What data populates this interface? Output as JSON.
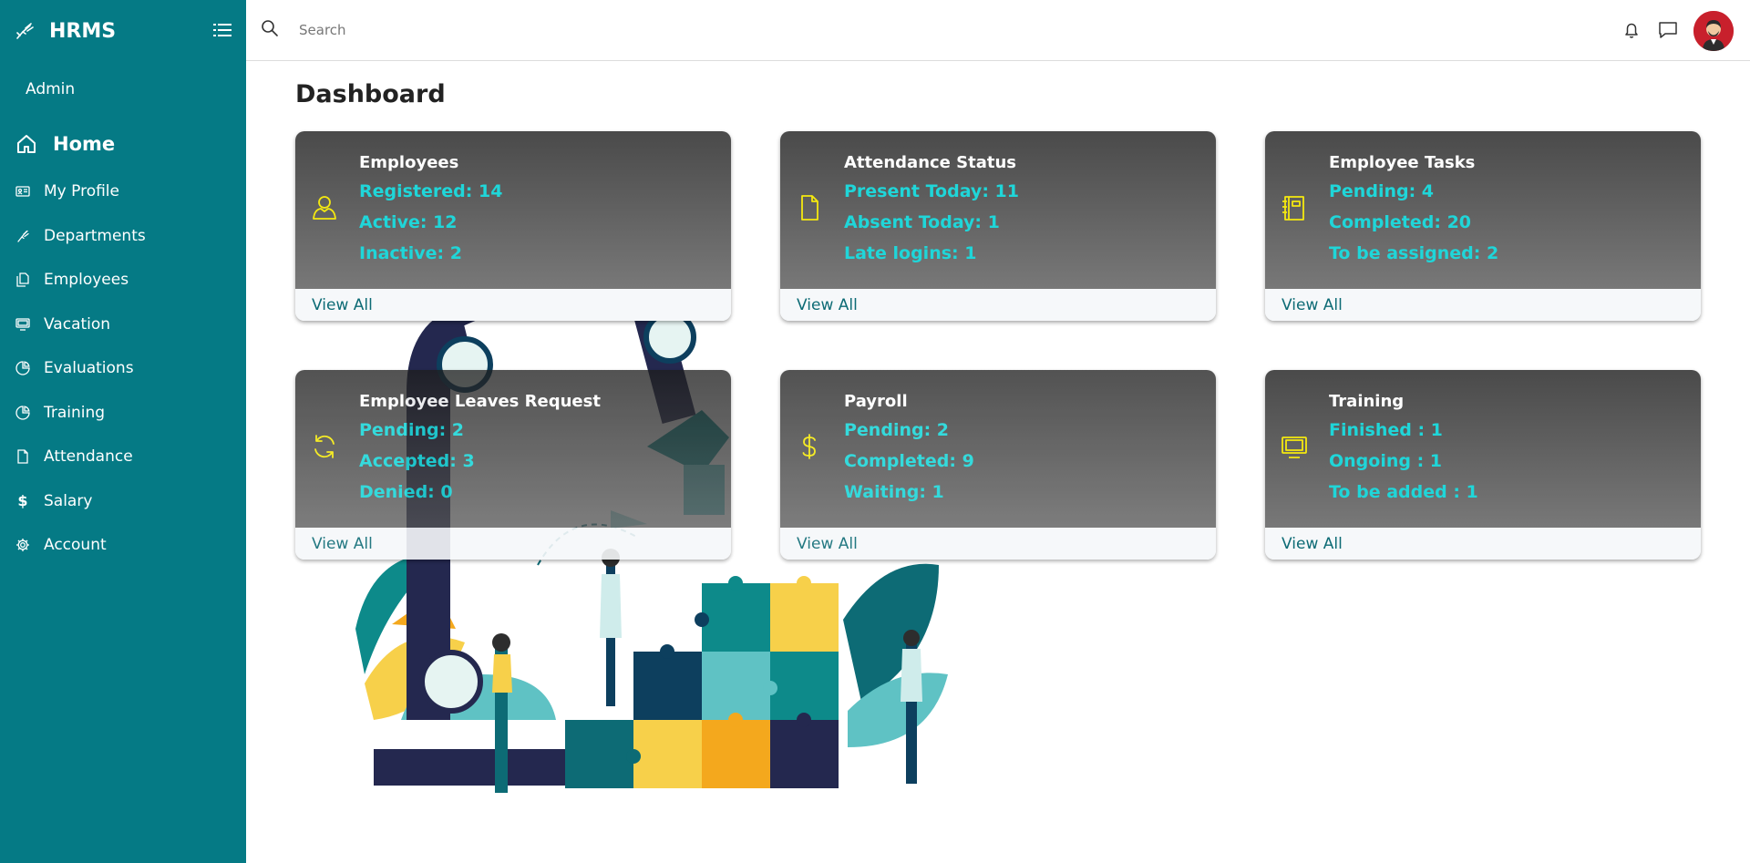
{
  "app": {
    "name": "HRMS",
    "role": "Admin"
  },
  "sidebar": {
    "items": [
      {
        "label": "Home",
        "icon": "home-icon"
      },
      {
        "label": "My Profile",
        "icon": "id-card-icon"
      },
      {
        "label": "Departments",
        "icon": "hand-icon"
      },
      {
        "label": "Employees",
        "icon": "documents-icon"
      },
      {
        "label": "Vacation",
        "icon": "monitor-icon"
      },
      {
        "label": "Evaluations",
        "icon": "pie-chart-icon"
      },
      {
        "label": "Training",
        "icon": "pie-chart-icon"
      },
      {
        "label": "Attendance",
        "icon": "file-icon"
      },
      {
        "label": "Salary",
        "icon": "dollar-icon"
      },
      {
        "label": "Account",
        "icon": "gear-icon"
      }
    ]
  },
  "header": {
    "search_placeholder": "Search"
  },
  "main": {
    "title": "Dashboard"
  },
  "cards": [
    {
      "title": "Employees",
      "icon": "user-icon",
      "lines": [
        "Registered: 14",
        "Active: 12",
        "Inactive: 2"
      ],
      "footer": "View All"
    },
    {
      "title": "Attendance Status",
      "icon": "file-icon",
      "lines": [
        "Present Today: 11",
        "Absent Today: 1",
        "Late logins: 1"
      ],
      "footer": "View All"
    },
    {
      "title": "Employee Tasks",
      "icon": "notebook-icon",
      "lines": [
        "Pending: 4",
        "Completed: 20",
        "To be assigned: 2"
      ],
      "footer": "View All"
    },
    {
      "title": "Employee Leaves Request",
      "icon": "refresh-icon",
      "lines": [
        "Pending: 2",
        "Accepted: 3",
        "Denied: 0"
      ],
      "footer": "View All"
    },
    {
      "title": "Payroll",
      "icon": "dollar-icon",
      "lines": [
        "Pending: 2",
        "Completed: 9",
        "Waiting: 1"
      ],
      "footer": "View All"
    },
    {
      "title": "Training",
      "icon": "monitor-icon",
      "lines": [
        "Finished : 1",
        "Ongoing : 1",
        "To be added : 1"
      ],
      "footer": "View All"
    }
  ],
  "colors": {
    "sidebar": "#057a85",
    "card_accent": "#1fd6d9",
    "card_icon": "#f5e90f",
    "footer_link": "#0d6b75"
  }
}
